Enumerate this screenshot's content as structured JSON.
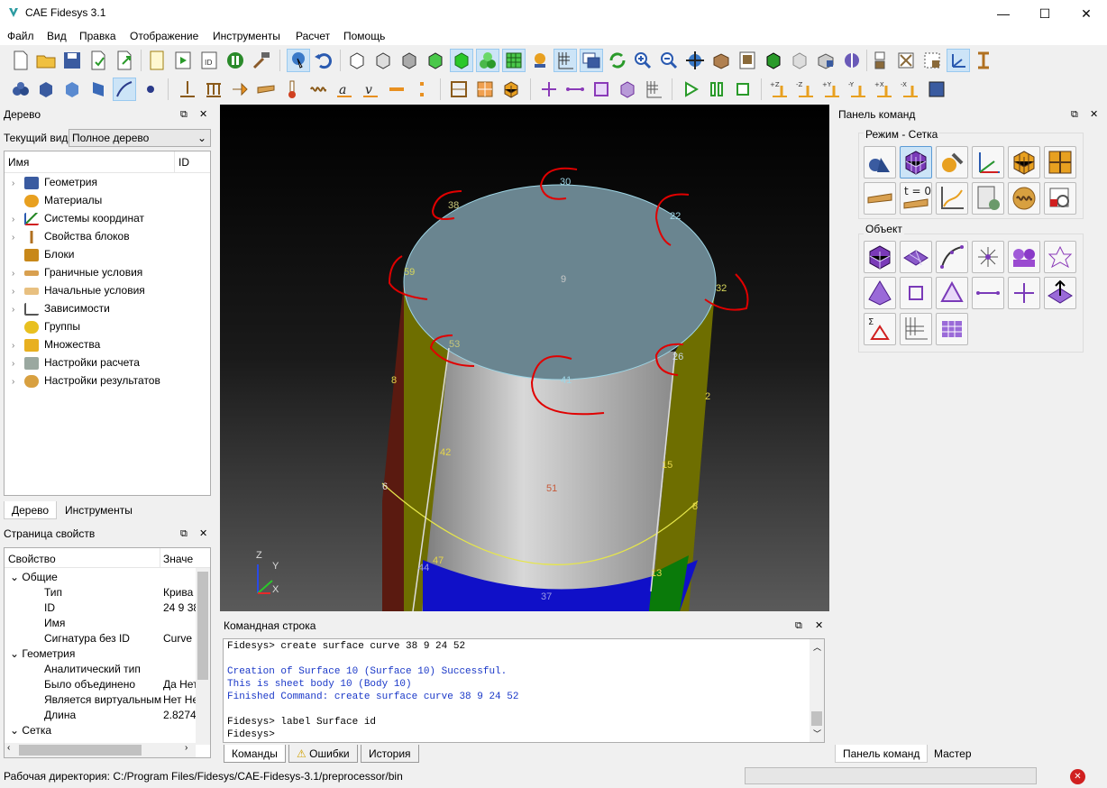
{
  "window": {
    "title": "CAE Fidesys 3.1"
  },
  "menu": [
    "Файл",
    "Вид",
    "Правка",
    "Отображение",
    "Инструменты",
    "Расчет",
    "Помощь"
  ],
  "tree_panel": {
    "title": "Дерево",
    "view_label": "Текущий вид",
    "view_value": "Полное дерево",
    "col_name": "Имя",
    "col_id": "ID",
    "items": [
      "Геометрия",
      "Материалы",
      "Системы координат",
      "Свойства блоков",
      "Блоки",
      "Граничные условия",
      "Начальные условия",
      "Зависимости",
      "Группы",
      "Множества",
      "Настройки расчета",
      "Настройки результатов"
    ],
    "tabs": [
      "Дерево",
      "Инструменты"
    ]
  },
  "props_panel": {
    "title": "Страница свойств",
    "col_prop": "Свойство",
    "col_val": "Значе",
    "rows": [
      {
        "name": "Общие",
        "value": "",
        "group": true
      },
      {
        "name": "Тип",
        "value": "Крива"
      },
      {
        "name": "ID",
        "value": "24 9 38"
      },
      {
        "name": "Имя",
        "value": ""
      },
      {
        "name": "Сигнатура без ID",
        "value": "Curve"
      },
      {
        "name": "Геометрия",
        "value": "",
        "group": true
      },
      {
        "name": "Аналитический тип",
        "value": ""
      },
      {
        "name": "Было объединено",
        "value": "Да Нет"
      },
      {
        "name": "Является виртуальным",
        "value": "Нет Не"
      },
      {
        "name": "Длина",
        "value": "2.8274:"
      },
      {
        "name": "Сетка",
        "value": "",
        "group": true
      }
    ]
  },
  "viewport": {
    "labels": [
      {
        "t": "38",
        "c": "#c6c67a"
      },
      {
        "t": "30",
        "c": "#9ed6e6"
      },
      {
        "t": "22",
        "c": "#9ed6e6"
      },
      {
        "t": "59",
        "c": "#d6d65a"
      },
      {
        "t": "9",
        "c": "#c8c8c8"
      },
      {
        "t": "32",
        "c": "#d6d65a"
      },
      {
        "t": "53",
        "c": "#c6c67a"
      },
      {
        "t": "41",
        "c": "#9ed6e6"
      },
      {
        "t": "26",
        "c": "#c8d8e6"
      },
      {
        "t": "8",
        "c": "#e6d64a"
      },
      {
        "t": "2",
        "c": "#e6d64a"
      },
      {
        "t": "42",
        "c": "#e6d64a"
      },
      {
        "t": "15",
        "c": "#e6d64a"
      },
      {
        "t": "51",
        "c": "#c65a3a"
      },
      {
        "t": "6",
        "c": "#dddddd"
      },
      {
        "t": "8",
        "c": "#e6d64a"
      },
      {
        "t": "47",
        "c": "#e6d64a"
      },
      {
        "t": "44",
        "c": "#9a9ae6"
      },
      {
        "t": "13",
        "c": "#e6d64a"
      },
      {
        "t": "37",
        "c": "#9a9ae6"
      }
    ],
    "axes": {
      "z": "Z",
      "y": "Y",
      "x": "X"
    }
  },
  "cmd_panel": {
    "title": "Панель команд",
    "mode_label": "Режим - Сетка",
    "object_label": "Объект",
    "tabs": [
      "Панель команд",
      "Мастер"
    ],
    "mode_icons": [
      "geometry-mode-icon",
      "mesh-mode-icon",
      "material-mode-icon",
      "coordinate-system-icon",
      "blocks-icon",
      "element-icon",
      "boundary-conditions-icon",
      "initial-conditions-icon",
      "dependency-icon",
      "calculation-icon",
      "results-icon",
      "inspect-icon"
    ],
    "t0": "t = 0"
  },
  "console": {
    "title": "Командная строка",
    "lines": [
      {
        "t": "Fidesys> create surface curve 38 9 24 52",
        "blue": false
      },
      {
        "t": "",
        "blue": false
      },
      {
        "t": "Creation of Surface 10 (Surface 10) Successful.",
        "blue": true
      },
      {
        "t": "This is sheet body 10 (Body 10)",
        "blue": true
      },
      {
        "t": "Finished Command: create surface curve 38 9 24 52",
        "blue": true
      },
      {
        "t": "",
        "blue": false
      },
      {
        "t": "Fidesys> label Surface id",
        "blue": false
      },
      {
        "t": "Fidesys>",
        "blue": false
      }
    ],
    "tabs": [
      "Команды",
      "Ошибки",
      "История"
    ]
  },
  "status": {
    "workdir": "Рабочая директория: C:/Program Files/Fidesys/CAE-Fidesys-3.1/preprocessor/bin"
  },
  "colors": {
    "accent": "#cce4f7",
    "surface": "#6a8590",
    "yellow": "#6e6e00",
    "blue_face": "#1010c8",
    "annot": "#e00000"
  }
}
